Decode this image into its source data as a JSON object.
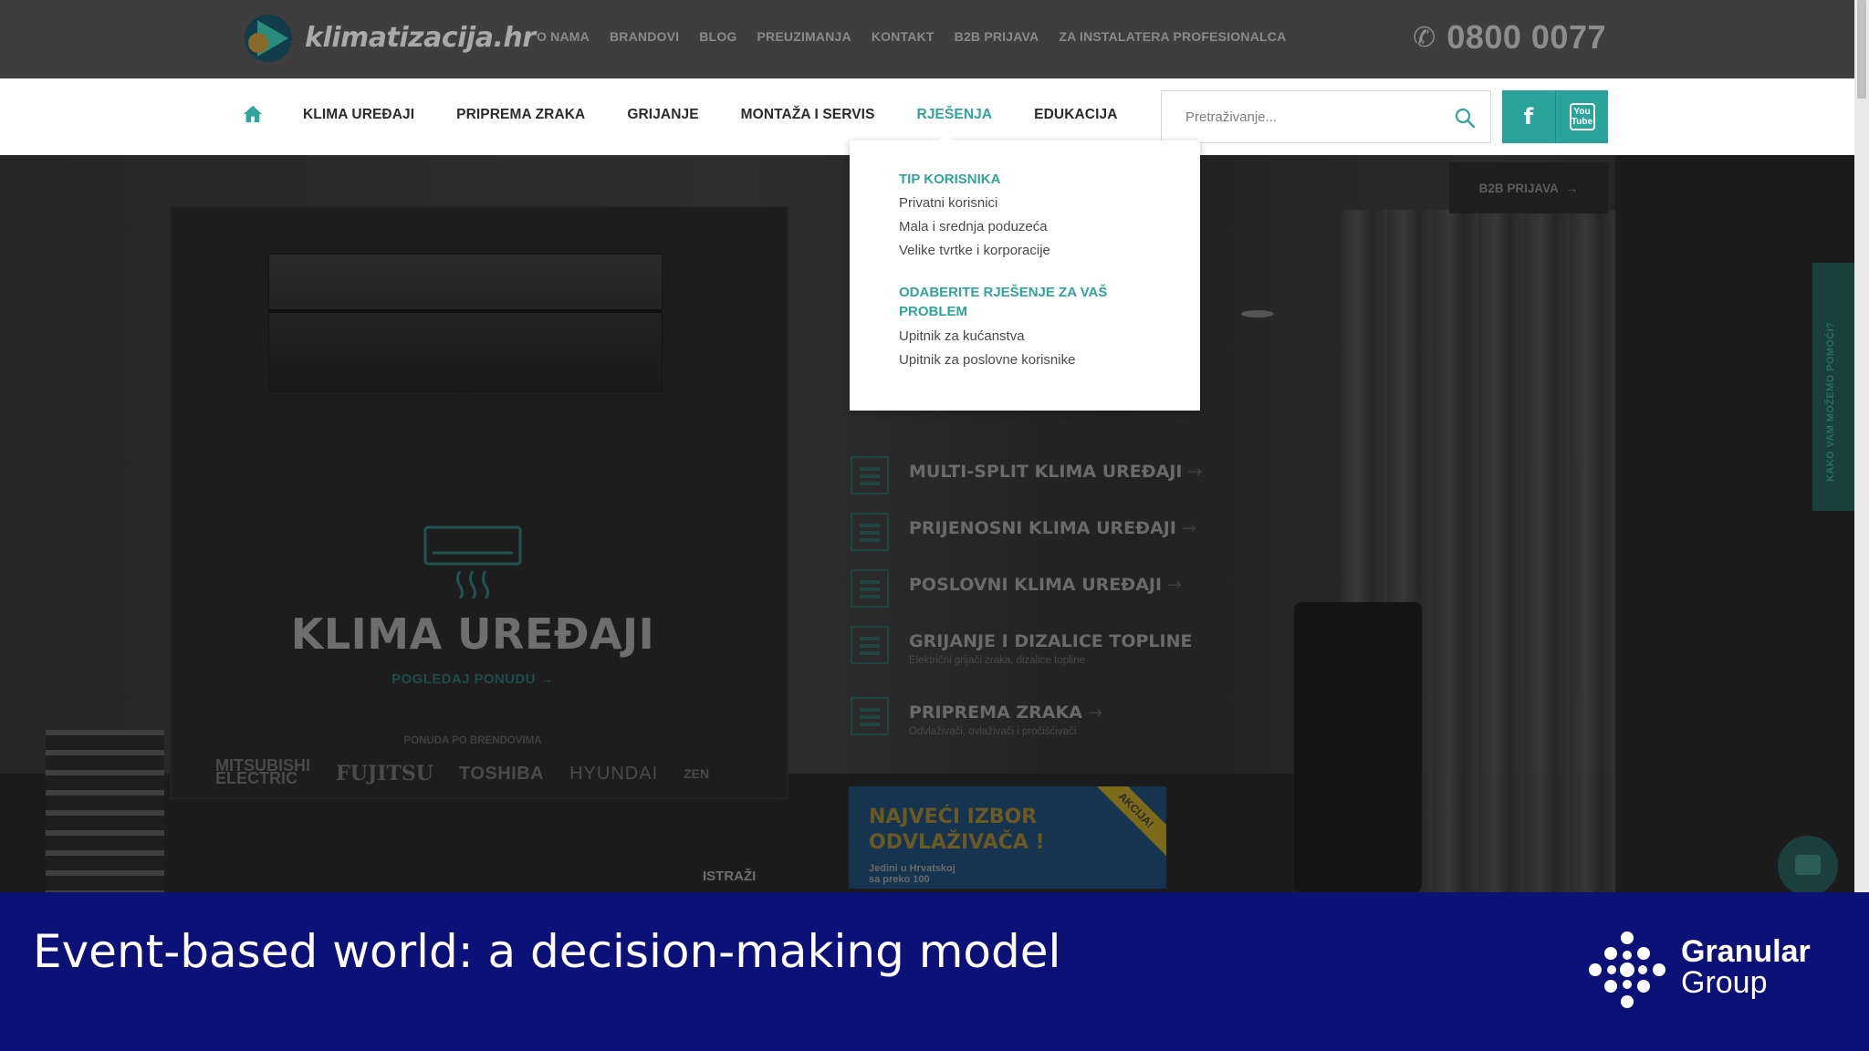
{
  "header": {
    "logo_text": "klimatizacija.hr",
    "top_links": [
      "O NAMA",
      "BRANDOVI",
      "BLOG",
      "PREUZIMANJA",
      "KONTAKT",
      "B2B PRIJAVA",
      "ZA INSTALATERA PROFESIONALCA"
    ],
    "phone": "0800 0077"
  },
  "nav": {
    "items": [
      "KLIMA UREĐAJI",
      "PRIPREMA ZRAKA",
      "GRIJANJE",
      "MONTAŽA I SERVIS",
      "RJEŠENJA",
      "EDUKACIJA"
    ],
    "active": "RJEŠENJA",
    "search_placeholder": "Pretraživanje...",
    "facebook_label": "f",
    "youtube_label_1": "You",
    "youtube_label_2": "Tube"
  },
  "dropdown": {
    "section1_title": "TIP KORISNIKA",
    "section1_items": [
      "Privatni korisnici",
      "Mala i srednja poduzeća",
      "Velike tvrtke i korporacije"
    ],
    "section2_title": "ODABERITE RJEŠENJE ZA VAŠ PROBLEM",
    "section2_items": [
      "Upitnik za kućanstva",
      "Upitnik za poslovne korisnike"
    ]
  },
  "hero": {
    "b2b_button": "B2B PRIJAVA",
    "b2b_arrow": "→",
    "klima_title": "KLIMA UREĐAJI",
    "klima_link": "POGLEDAJ PONUDU →",
    "brands_label": "PONUDA PO BRENDOVIMA",
    "brands": {
      "mitsubishi_1": "MITSUBISHI",
      "mitsubishi_2": "ELECTRIC",
      "fujitsu": "FUJITSU",
      "toshiba": "TOSHIBA",
      "hyundai": "HYUNDAI",
      "zen": "ZEN"
    },
    "categories": [
      {
        "title": "MULTI-SPLIT KLIMA UREĐAJI",
        "subtitle": ""
      },
      {
        "title": "PRIJENOSNI KLIMA UREĐAJI",
        "subtitle": ""
      },
      {
        "title": "POSLOVNI KLIMA UREĐAJI",
        "subtitle": ""
      },
      {
        "title": "GRIJANJE I DIZALICE TOPLINE",
        "subtitle": "Električni grijači zraka, dizalice topline"
      },
      {
        "title": "PRIPREMA ZRAKA",
        "subtitle": "Odvlaživači, ovlaživači i pročišćivači"
      }
    ],
    "category_arrow": "→",
    "promo_tag": "AKCIJA!",
    "promo_line1": "NAJVEĆI IZBOR",
    "promo_line2": "ODVLAŽIVAČA !",
    "promo_sub1": "Jedini u Hrvatskoj",
    "promo_sub2": "sa preko 100",
    "istrazi": "ISTRAŽI",
    "side_tab": "KAKO VAM MOŽEMO POMOĆI?"
  },
  "banner": {
    "title": "Event-based world: a decision-making model",
    "brand_line1": "Granular",
    "brand_line2": "Group"
  },
  "colors": {
    "accent": "#2fa59c",
    "banner_bg": "#0b1177",
    "topbar_bg": "#3e3e3e"
  }
}
